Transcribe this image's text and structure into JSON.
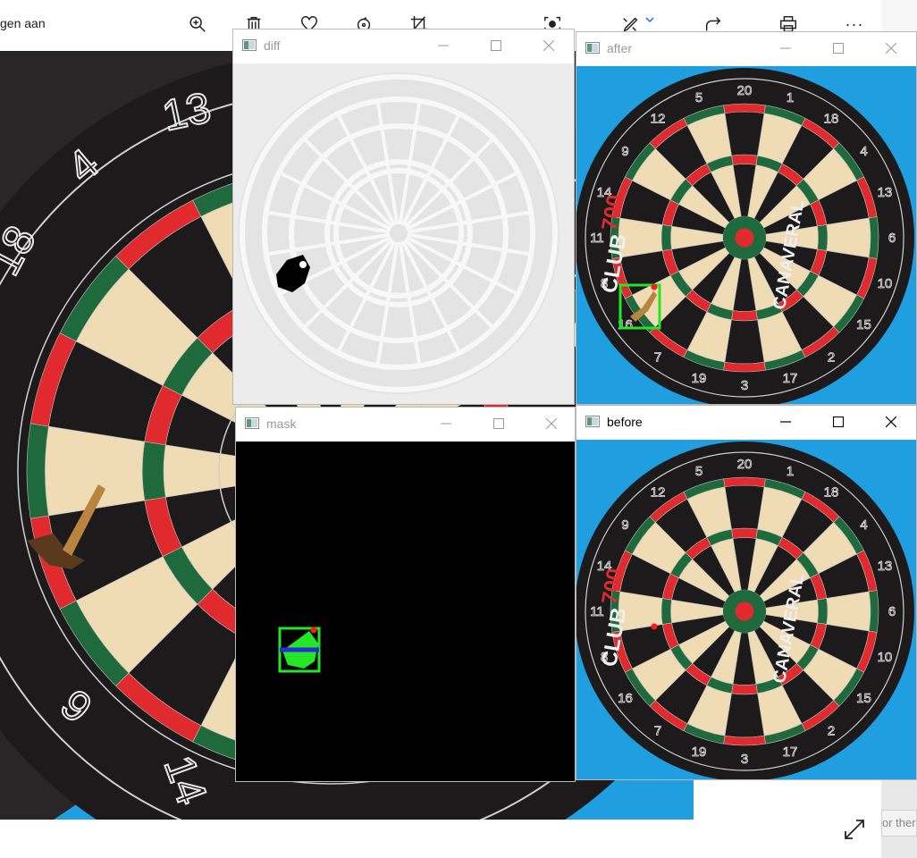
{
  "photos_app": {
    "title_fragment": "gen aan",
    "toolbar": [
      {
        "icon": "zoom-in-icon"
      },
      {
        "icon": "trash-icon"
      },
      {
        "icon": "heart-icon"
      },
      {
        "icon": "rotate-icon"
      },
      {
        "icon": "crop-icon"
      },
      {
        "icon": "face-scan-icon"
      },
      {
        "icon": "edit-icon"
      },
      {
        "icon": "share-icon"
      },
      {
        "icon": "print-icon"
      },
      {
        "icon": "more-icon",
        "label": "···"
      }
    ],
    "search_stub": "or ther",
    "expand_icon": "expand-icon"
  },
  "board_numbers": [
    "20",
    "1",
    "18",
    "4",
    "13",
    "6",
    "10",
    "15",
    "2",
    "17",
    "3",
    "19",
    "7",
    "16",
    "8",
    "11",
    "14",
    "9",
    "12",
    "5"
  ],
  "brand": {
    "club": "CLUB",
    "model": "700",
    "name": "CANAVERAL"
  },
  "windows": {
    "diff": {
      "title": "diff"
    },
    "after": {
      "title": "after"
    },
    "mask": {
      "title": "mask"
    },
    "before": {
      "title": "before"
    }
  },
  "colors": {
    "board_black": "#1c1a1b",
    "board_cream": "#efdcb4",
    "ring_red": "#e02a2e",
    "ring_green": "#1f6a3c",
    "wall_blue": "#1f9ee0",
    "detect_green": "#22e626",
    "marker_red": "#ff1a1a",
    "mask_blue": "#2a2ad6"
  }
}
